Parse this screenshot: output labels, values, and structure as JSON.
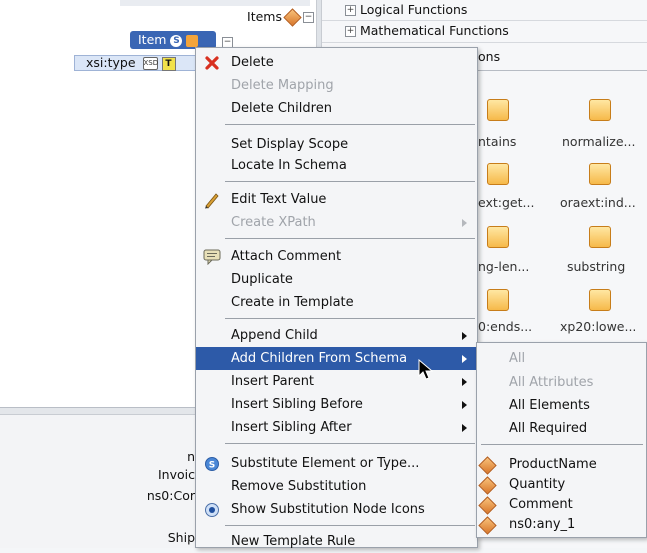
{
  "tree": {
    "items_label": "Items",
    "item_label": "Item",
    "item_badge": "S",
    "xsitype_label": "xsi:type",
    "xsitype_badge": "T",
    "xsd_chip": "XSD"
  },
  "bottom_left": {
    "line1": "n",
    "line2": "Invoic",
    "line3": "ns0:Cor",
    "line4": "Ship"
  },
  "components": {
    "categories": [
      {
        "label": "Logical Functions",
        "expander": "+"
      },
      {
        "label": "Mathematical Functions",
        "expander": "+"
      },
      {
        "label": "ons",
        "expander": ""
      }
    ],
    "functions": [
      {
        "label": "ntains"
      },
      {
        "label": "normalize..."
      },
      {
        "label": "ext:get..."
      },
      {
        "label": "oraext:ind..."
      },
      {
        "label": "ng-len..."
      },
      {
        "label": "substring"
      },
      {
        "label": "0:ends..."
      },
      {
        "label": "xp20:lowe..."
      }
    ]
  },
  "context_menu": {
    "items": [
      {
        "label": "Delete",
        "enabled": true,
        "icon": "delete-x-icon"
      },
      {
        "label": "Delete Mapping",
        "enabled": false
      },
      {
        "label": "Delete Children",
        "enabled": true
      },
      {
        "label": "Set Display Scope",
        "enabled": true
      },
      {
        "label": "Locate In Schema",
        "enabled": true
      },
      {
        "label": "Edit Text Value",
        "enabled": true,
        "icon": "pencil-icon"
      },
      {
        "label": "Create XPath",
        "enabled": false,
        "submenu": true
      },
      {
        "label": "Attach Comment",
        "enabled": true,
        "icon": "comment-icon"
      },
      {
        "label": "Duplicate",
        "enabled": true
      },
      {
        "label": "Create in Template",
        "enabled": true
      },
      {
        "label": "Append Child",
        "enabled": true,
        "submenu": true
      },
      {
        "label": "Add Children From Schema",
        "enabled": true,
        "submenu": true,
        "selected": true
      },
      {
        "label": "Insert Parent",
        "enabled": true,
        "submenu": true
      },
      {
        "label": "Insert Sibling Before",
        "enabled": true,
        "submenu": true
      },
      {
        "label": "Insert Sibling After",
        "enabled": true,
        "submenu": true
      },
      {
        "label": "Substitute Element or Type...",
        "enabled": true,
        "icon": "substitute-icon"
      },
      {
        "label": "Remove Substitution",
        "enabled": true
      },
      {
        "label": "Show Substitution Node Icons",
        "enabled": true,
        "icon": "radio-dot-icon"
      },
      {
        "label": "New Template Rule",
        "enabled": true
      }
    ]
  },
  "submenu": {
    "items": [
      {
        "label": "All",
        "enabled": false
      },
      {
        "label": "All Attributes",
        "enabled": false
      },
      {
        "label": "All Elements",
        "enabled": true
      },
      {
        "label": "All Required",
        "enabled": true
      },
      {
        "label": "ProductName",
        "enabled": true,
        "icon": "element-icon"
      },
      {
        "label": "Quantity",
        "enabled": true,
        "icon": "element-icon"
      },
      {
        "label": "Comment",
        "enabled": true,
        "icon": "element-icon"
      },
      {
        "label": "ns0:any_1",
        "enabled": true,
        "icon": "element-icon"
      }
    ]
  },
  "colors": {
    "selection": "#2d5aa8",
    "disabled_text": "#a0a4aa",
    "element_icon": "#e08a3a"
  }
}
